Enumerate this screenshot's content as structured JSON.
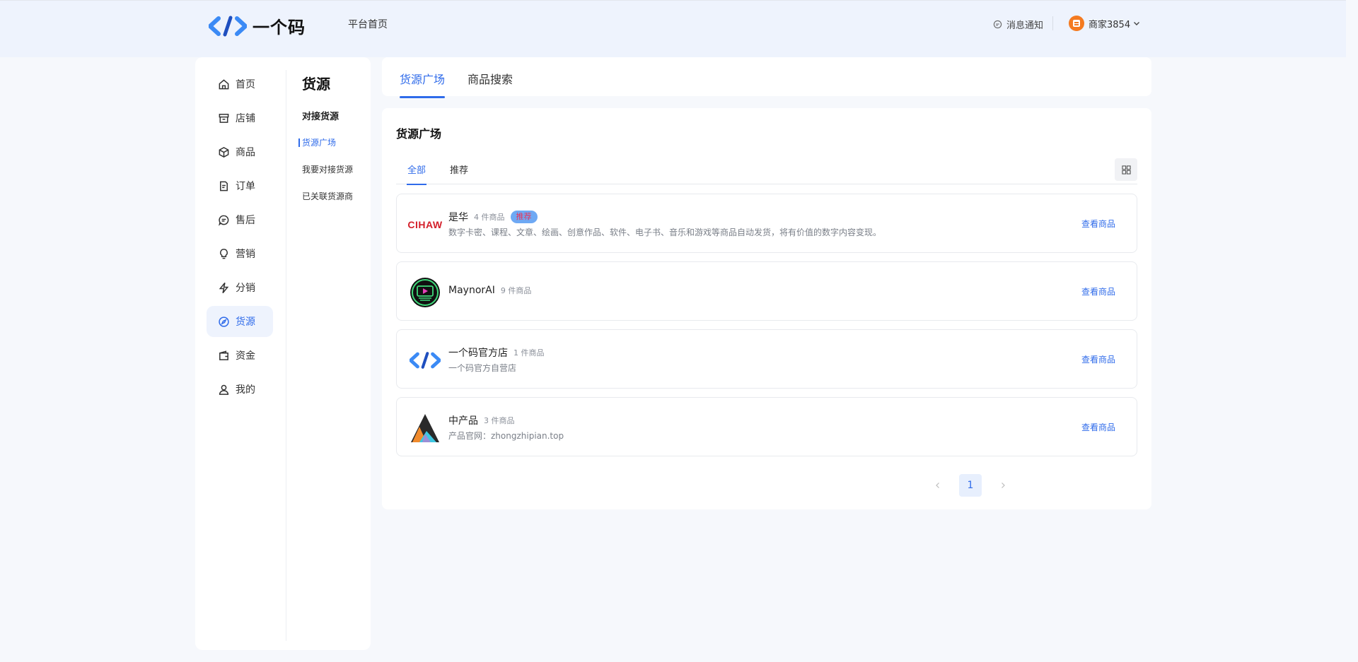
{
  "header": {
    "brand_name": "一个码",
    "platform_home": "平台首页",
    "notice_label": "消息通知",
    "user_name": "商家3854"
  },
  "nav": {
    "items": [
      {
        "label": "首页",
        "icon": "home-icon"
      },
      {
        "label": "店铺",
        "icon": "store-icon"
      },
      {
        "label": "商品",
        "icon": "box-icon"
      },
      {
        "label": "订单",
        "icon": "order-icon"
      },
      {
        "label": "售后",
        "icon": "chat-icon"
      },
      {
        "label": "营销",
        "icon": "bulb-icon"
      },
      {
        "label": "分销",
        "icon": "bolt-icon"
      },
      {
        "label": "货源",
        "icon": "compass-icon"
      },
      {
        "label": "资金",
        "icon": "wallet-icon"
      },
      {
        "label": "我的",
        "icon": "user-icon"
      }
    ],
    "active": "货源"
  },
  "subnav": {
    "title": "货源",
    "group": "对接货源",
    "items": [
      "货源广场",
      "我要对接货源",
      "已关联货源商"
    ]
  },
  "main_tabs": [
    "货源广场",
    "商品搜索"
  ],
  "section": {
    "title": "货源广场",
    "filters": [
      "全部",
      "推荐"
    ]
  },
  "suppliers": [
    {
      "name": "是华",
      "count": "4 件商品",
      "badge": "推荐",
      "desc": "数字卡密、课程、文章、绘画、创意作品、软件、电子书、音乐和游戏等商品自动发货，将有价值的数字内容变现。",
      "logo_text": "CIHAW",
      "action": "查看商品"
    },
    {
      "name": "MaynorAI",
      "count": "9 件商品",
      "badge": "",
      "desc": "",
      "action": "查看商品"
    },
    {
      "name": "一个码官方店",
      "count": "1 件商品",
      "badge": "",
      "desc": "一个码官方自营店",
      "action": "查看商品"
    },
    {
      "name": "中产品",
      "count": "3 件商品",
      "badge": "",
      "desc": "产品官网：zhongzhipian.top",
      "action": "查看商品"
    }
  ],
  "pagination": {
    "current": "1"
  },
  "colors": {
    "accent": "#2f6bea",
    "badge_bg": "#6ea9f4",
    "badge_text": "#e8355a",
    "brand_red": "#d4202b"
  }
}
